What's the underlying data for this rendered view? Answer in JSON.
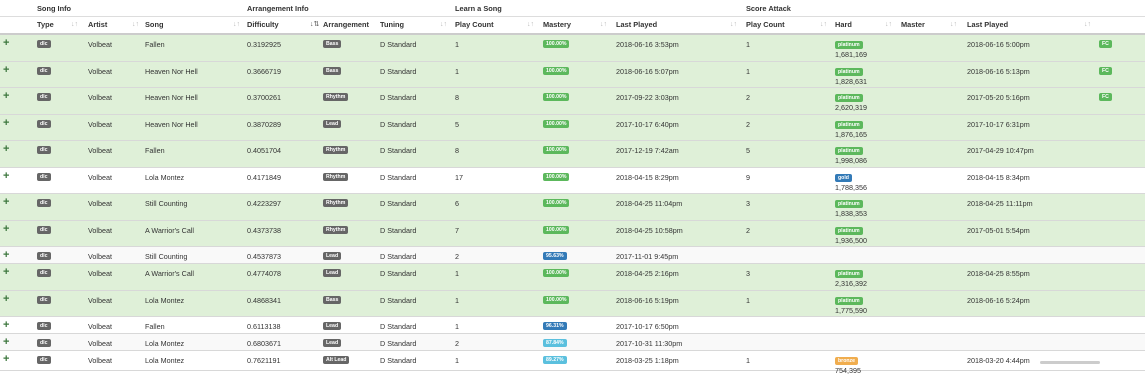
{
  "groups": {
    "song_info": "Song Info",
    "arrangement_info": "Arrangement Info",
    "learn_a_song": "Learn a Song",
    "score_attack": "Score Attack"
  },
  "columns": {
    "type": "Type",
    "artist": "Artist",
    "song": "Song",
    "difficulty": "Difficulty",
    "arrangement": "Arrangement",
    "tuning": "Tuning",
    "play_count": "Play Count",
    "mastery": "Mastery",
    "last_played": "Last Played",
    "sa_play_count": "Play Count",
    "hard": "Hard",
    "master": "Master",
    "sa_last_played": "Last Played"
  },
  "sort_icon": "↓↑",
  "sort_icon_active": "↓⇅",
  "add_icon": "+",
  "colors": {
    "row_green": "#dff0d8",
    "mastery_full": "#5cb85c",
    "mastery_high": "#337ab7",
    "mastery_mid": "#5bc0de",
    "badge_dark": "#666666",
    "bronze": "#f0ad4e"
  },
  "rows": [
    {
      "type": "dlc",
      "artist": "Volbeat",
      "song": "Fallen",
      "difficulty": "0.3192925",
      "arrangement": "Bass",
      "tuning": "D Standard",
      "play_count": "1",
      "mastery": "100.00%",
      "mastery_color": "green",
      "last_played": "2018-06-16 3:53pm",
      "sa_play_count": "1",
      "hard_badge": "platinum",
      "hard_badge_color": "green",
      "hard_score": "1,681,169",
      "sa_last_played": "2018-06-16 5:00pm",
      "fc": "FC",
      "style": "green"
    },
    {
      "type": "dlc",
      "artist": "Volbeat",
      "song": "Heaven Nor Hell",
      "difficulty": "0.3666719",
      "arrangement": "Bass",
      "tuning": "D Standard",
      "play_count": "1",
      "mastery": "100.00%",
      "mastery_color": "green",
      "last_played": "2018-06-16 5:07pm",
      "sa_play_count": "1",
      "hard_badge": "platinum",
      "hard_badge_color": "green",
      "hard_score": "1,828,631",
      "sa_last_played": "2018-06-16 5:13pm",
      "fc": "FC",
      "style": "green"
    },
    {
      "type": "dlc",
      "artist": "Volbeat",
      "song": "Heaven Nor Hell",
      "difficulty": "0.3700261",
      "arrangement": "Rhythm",
      "tuning": "D Standard",
      "play_count": "8",
      "mastery": "100.00%",
      "mastery_color": "green",
      "last_played": "2017-09-22 3:03pm",
      "sa_play_count": "2",
      "hard_badge": "platinum",
      "hard_badge_color": "green",
      "hard_score": "2,620,319",
      "sa_last_played": "2017-05-20 5:16pm",
      "fc": "FC",
      "style": "green"
    },
    {
      "type": "dlc",
      "artist": "Volbeat",
      "song": "Heaven Nor Hell",
      "difficulty": "0.3870289",
      "arrangement": "Lead",
      "tuning": "D Standard",
      "play_count": "5",
      "mastery": "100.00%",
      "mastery_color": "green",
      "last_played": "2017-10-17 6:40pm",
      "sa_play_count": "2",
      "hard_badge": "platinum",
      "hard_badge_color": "green",
      "hard_score": "1,876,165",
      "sa_last_played": "2017-10-17 6:31pm",
      "fc": "",
      "style": "green"
    },
    {
      "type": "dlc",
      "artist": "Volbeat",
      "song": "Fallen",
      "difficulty": "0.4051704",
      "arrangement": "Rhythm",
      "tuning": "D Standard",
      "play_count": "8",
      "mastery": "100.00%",
      "mastery_color": "green",
      "last_played": "2017-12-19 7:42am",
      "sa_play_count": "5",
      "hard_badge": "platinum",
      "hard_badge_color": "green",
      "hard_score": "1,998,086",
      "sa_last_played": "2017-04-29 10:47pm",
      "fc": "",
      "style": "green"
    },
    {
      "type": "dlc",
      "artist": "Volbeat",
      "song": "Lola Montez",
      "difficulty": "0.4171849",
      "arrangement": "Rhythm",
      "tuning": "D Standard",
      "play_count": "17",
      "mastery": "100.00%",
      "mastery_color": "green",
      "last_played": "2018-04-15 8:29pm",
      "sa_play_count": "9",
      "hard_badge": "gold",
      "hard_badge_color": "blue",
      "hard_score": "1,788,356",
      "sa_last_played": "2018-04-15 8:34pm",
      "fc": "",
      "style": "plain"
    },
    {
      "type": "dlc",
      "artist": "Volbeat",
      "song": "Still Counting",
      "difficulty": "0.4223297",
      "arrangement": "Rhythm",
      "tuning": "D Standard",
      "play_count": "6",
      "mastery": "100.00%",
      "mastery_color": "green",
      "last_played": "2018-04-25 11:04pm",
      "sa_play_count": "3",
      "hard_badge": "platinum",
      "hard_badge_color": "green",
      "hard_score": "1,838,353",
      "sa_last_played": "2018-04-25 11:11pm",
      "fc": "",
      "style": "green"
    },
    {
      "type": "dlc",
      "artist": "Volbeat",
      "song": "A Warrior's Call",
      "difficulty": "0.4373738",
      "arrangement": "Rhythm",
      "tuning": "D Standard",
      "play_count": "7",
      "mastery": "100.00%",
      "mastery_color": "green",
      "last_played": "2018-04-25 10:58pm",
      "sa_play_count": "2",
      "hard_badge": "platinum",
      "hard_badge_color": "green",
      "hard_score": "1,936,500",
      "sa_last_played": "2017-05-01 5:54pm",
      "fc": "",
      "style": "green"
    },
    {
      "type": "dlc",
      "artist": "Volbeat",
      "song": "Still Counting",
      "difficulty": "0.4537873",
      "arrangement": "Lead",
      "tuning": "D Standard",
      "play_count": "2",
      "mastery": "95.63%",
      "mastery_color": "blue",
      "last_played": "2017-11-01 9:45pm",
      "sa_play_count": "",
      "hard_badge": "",
      "hard_badge_color": "",
      "hard_score": "",
      "sa_last_played": "",
      "fc": "",
      "style": "alt"
    },
    {
      "type": "dlc",
      "artist": "Volbeat",
      "song": "A Warrior's Call",
      "difficulty": "0.4774078",
      "arrangement": "Lead",
      "tuning": "D Standard",
      "play_count": "1",
      "mastery": "100.00%",
      "mastery_color": "green",
      "last_played": "2018-04-25 2:16pm",
      "sa_play_count": "3",
      "hard_badge": "platinum",
      "hard_badge_color": "green",
      "hard_score": "2,316,392",
      "sa_last_played": "2018-04-25 8:55pm",
      "fc": "",
      "style": "green"
    },
    {
      "type": "dlc",
      "artist": "Volbeat",
      "song": "Lola Montez",
      "difficulty": "0.4868341",
      "arrangement": "Bass",
      "tuning": "D Standard",
      "play_count": "1",
      "mastery": "100.00%",
      "mastery_color": "green",
      "last_played": "2018-06-16 5:19pm",
      "sa_play_count": "1",
      "hard_badge": "platinum",
      "hard_badge_color": "green",
      "hard_score": "1,775,590",
      "sa_last_played": "2018-06-16 5:24pm",
      "fc": "",
      "style": "green"
    },
    {
      "type": "dlc",
      "artist": "Volbeat",
      "song": "Fallen",
      "difficulty": "0.6113138",
      "arrangement": "Lead",
      "tuning": "D Standard",
      "play_count": "1",
      "mastery": "96.31%",
      "mastery_color": "blue",
      "last_played": "2017-10-17 6:50pm",
      "sa_play_count": "",
      "hard_badge": "",
      "hard_badge_color": "",
      "hard_score": "",
      "sa_last_played": "",
      "fc": "",
      "style": "plain"
    },
    {
      "type": "dlc",
      "artist": "Volbeat",
      "song": "Lola Montez",
      "difficulty": "0.6803671",
      "arrangement": "Lead",
      "tuning": "D Standard",
      "play_count": "2",
      "mastery": "87.84%",
      "mastery_color": "lblue",
      "last_played": "2017-10-31 11:30pm",
      "sa_play_count": "",
      "hard_badge": "",
      "hard_badge_color": "",
      "hard_score": "",
      "sa_last_played": "",
      "fc": "",
      "style": "alt"
    },
    {
      "type": "dlc",
      "artist": "Volbeat",
      "song": "Lola Montez",
      "difficulty": "0.7621191",
      "arrangement": "Alt Lead",
      "tuning": "D Standard",
      "play_count": "1",
      "mastery": "89.27%",
      "mastery_color": "lblue",
      "last_played": "2018-03-25 1:18pm",
      "sa_play_count": "1",
      "hard_badge": "bronze",
      "hard_badge_color": "orange",
      "hard_score": "754,395",
      "sa_last_played": "2018-03-20 4:44pm",
      "fc": "",
      "style": "plain"
    }
  ]
}
